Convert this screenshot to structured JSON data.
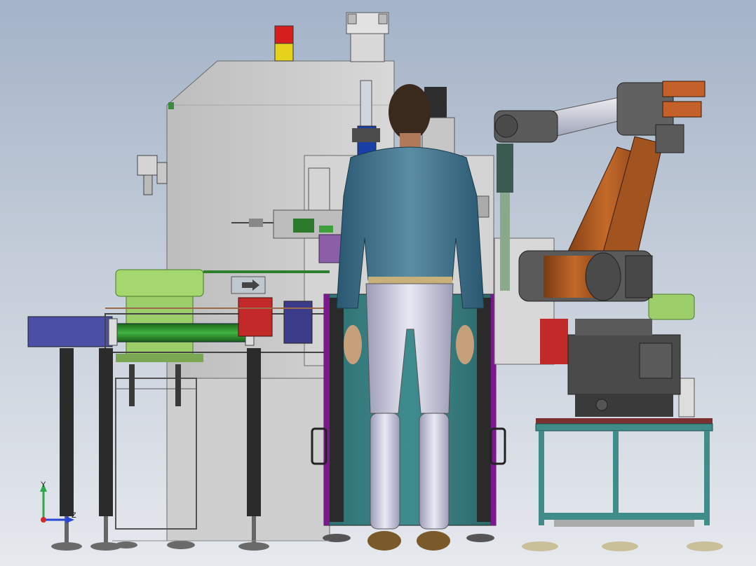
{
  "viewport": {
    "background_top": "#a4b3c8",
    "background_bottom": "#e6e9ee"
  },
  "scene": {
    "description_visible": false,
    "machine_color": "#c9c9c9",
    "frame_color": "#3a3a3a",
    "robot_color": "#b0591a",
    "feeder_color": "#9ccf6a",
    "conveyor_color": "#2f8a2f",
    "cart_frame_color": "#3f8c88"
  },
  "triad": {
    "y_label": "Y",
    "z_label": "Z",
    "y_color": "#2fa84f",
    "z_color": "#2a48d6",
    "origin_color": "#d12a2a"
  }
}
